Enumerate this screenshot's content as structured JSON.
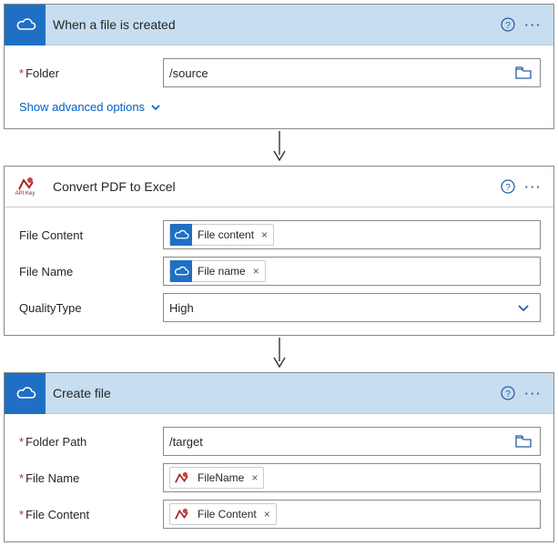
{
  "card1": {
    "title": "When a file is created",
    "fields": {
      "folder": {
        "label": "Folder",
        "value": "/source"
      }
    },
    "advanced": "Show advanced options"
  },
  "card2": {
    "title": "Convert PDF to Excel",
    "fields": {
      "file_content": {
        "label": "File Content",
        "token": "File content"
      },
      "file_name": {
        "label": "File Name",
        "token": "File name"
      },
      "quality": {
        "label": "QualityType",
        "value": "High"
      }
    }
  },
  "card3": {
    "title": "Create file",
    "fields": {
      "folder_path": {
        "label": "Folder Path",
        "value": "/target"
      },
      "file_name": {
        "label": "File Name",
        "token": "FileName"
      },
      "file_content": {
        "label": "File Content",
        "token": "File Content"
      }
    }
  }
}
